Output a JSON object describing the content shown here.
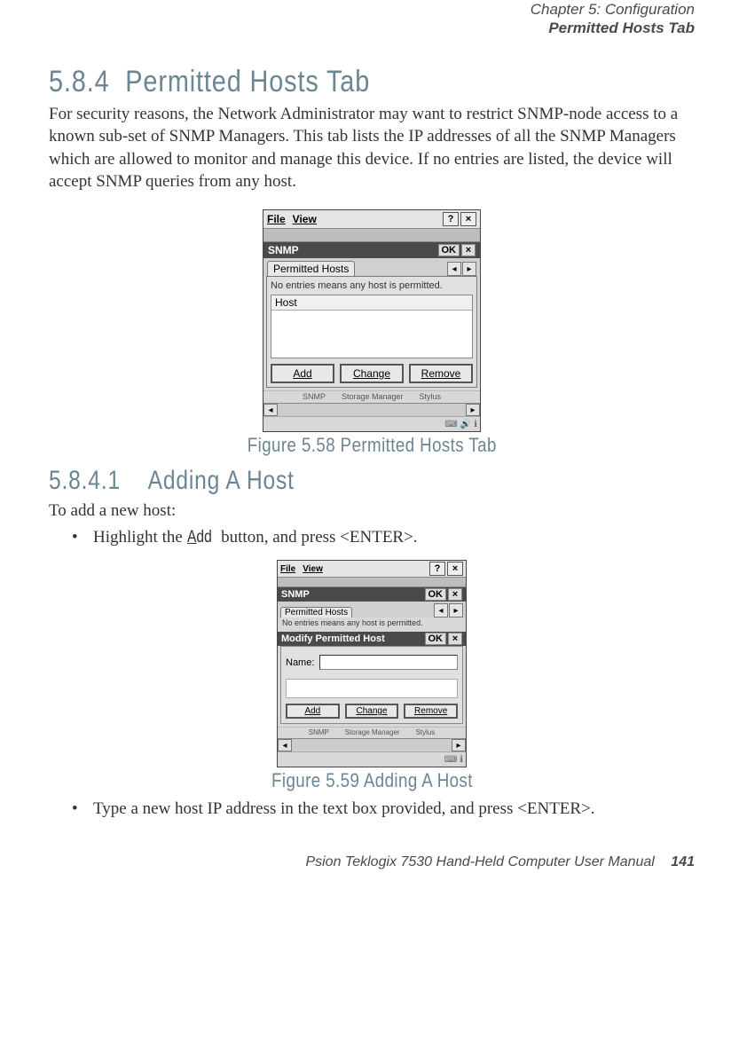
{
  "header": {
    "chapter": "Chapter 5: Configuration",
    "section": "Permitted Hosts Tab"
  },
  "section584": {
    "number": "5.8.4",
    "title": "Permitted Hosts Tab",
    "paragraph": "For security reasons, the Network Administrator may want to restrict SNMP-node access to a known sub-set of SNMP Managers. This tab lists the IP addresses of all the SNMP Managers which are allowed to monitor and manage this device. If no entries are listed, the device will accept SNMP queries from any host."
  },
  "fig1": {
    "menubar_file": "File",
    "menubar_view": "View",
    "help": "?",
    "close": "×",
    "title": "SNMP",
    "ok": "OK",
    "tab": "Permitted Hosts",
    "hint": "No entries means any host is permitted.",
    "host_col": "Host",
    "add": "Add",
    "change": "Change",
    "remove": "Remove",
    "icon1": "SNMP",
    "icon2": "Storage Manager",
    "icon3": "Stylus",
    "caption": "Figure 5.58 Permitted Hosts Tab"
  },
  "section5841": {
    "number": "5.8.4.1",
    "title": "Adding A Host",
    "intro": "To add a new host:",
    "bullet1_prefix": "Highlight the ",
    "bullet1_button": "Add",
    "bullet1_suffix": " button, and press <ENTER>."
  },
  "fig2": {
    "menubar_file": "File",
    "menubar_view": "View",
    "help": "?",
    "close": "×",
    "title1": "SNMP",
    "ok": "OK",
    "tab": "Permitted Hosts",
    "hint": "No entries means any host is permitted.",
    "title2": "Modify Permitted Host",
    "name_label": "Name:",
    "add": "Add",
    "change": "Change",
    "remove": "Remove",
    "icon1": "SNMP",
    "icon2": "Storage Manager",
    "icon3": "Stylus",
    "caption": "Figure 5.59 Adding A Host"
  },
  "bullet2": "Type a new host IP address in the text box provided, and press <ENTER>.",
  "footer": {
    "text": "Psion Teklogix 7530 Hand-Held Computer User Manual",
    "page": "141"
  }
}
